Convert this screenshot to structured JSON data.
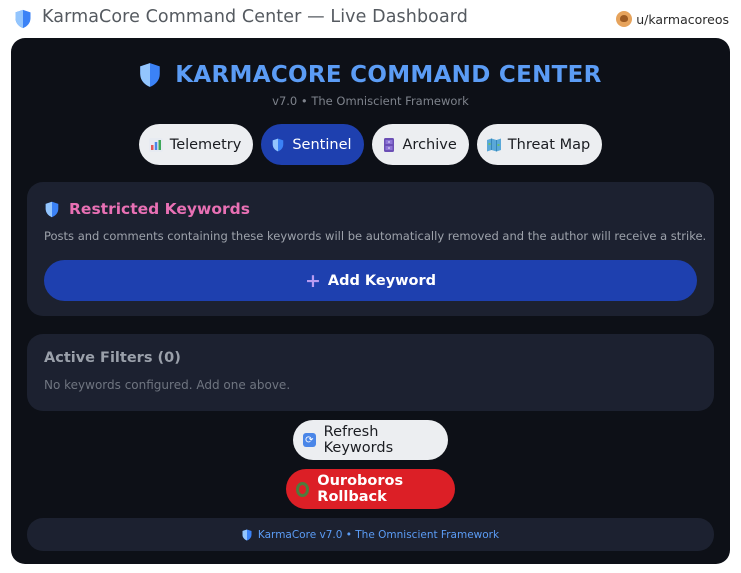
{
  "window": {
    "title": "KarmaCore Command Center — Live Dashboard",
    "title_icon": "shield-icon",
    "user": "u/karmacoreos"
  },
  "header": {
    "title": "KARMACORE COMMAND CENTER",
    "subtitle": "v7.0 • The Omniscient Framework"
  },
  "tabs": [
    {
      "label": "Telemetry",
      "icon": "bar-chart-icon",
      "active": false
    },
    {
      "label": "Sentinel",
      "icon": "shield-icon",
      "active": true
    },
    {
      "label": "Archive",
      "icon": "cabinet-icon",
      "active": false
    },
    {
      "label": "Threat Map",
      "icon": "map-icon",
      "active": false
    }
  ],
  "restricted": {
    "title": "Restricted Keywords",
    "description": "Posts and comments containing these keywords will be automatically removed and the author will receive a strike.",
    "add_button": "Add Keyword"
  },
  "filters": {
    "title": "Active Filters (0)",
    "empty_text": "No keywords configured. Add one above."
  },
  "actions": {
    "refresh": "Refresh Keywords",
    "rollback": "Ouroboros Rollback"
  },
  "footer": {
    "text": "KarmaCore v7.0 • The Omniscient Framework"
  },
  "colors": {
    "accent_blue": "#5b9cf5",
    "active_tab": "#1e40af",
    "pink_title": "#e870b4",
    "danger": "#dc1f26",
    "panel_bg": "#0d1017",
    "card_bg": "#1c2130"
  }
}
